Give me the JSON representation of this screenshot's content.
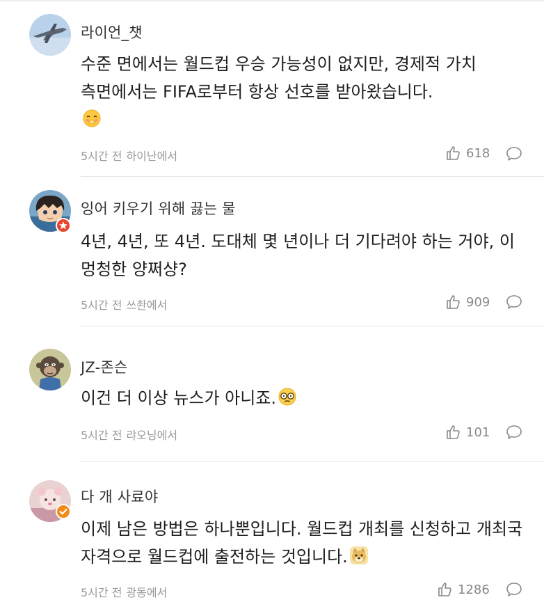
{
  "comments": [
    {
      "username": "라이언_챗",
      "text": "수준 면에서는 월드컵 우승 가능성이 없지만, 경제적 가치 측면에서는 FIFA로부터 항상 선호를 받아왔습니다.",
      "emoji": "shy-face-emoji",
      "time": "5시간 전",
      "location": "하이난에서",
      "likes": "618",
      "avatar": "jet-plane-avatar"
    },
    {
      "username": "잉어 키우기 위해 끓는 물",
      "text": "4년, 4년, 또 4년. 도대체 몇 년이나 더 기다려야 하는 거야, 이 멍청한 양쩌샹?",
      "emoji": "",
      "time": "5시간 전",
      "location": "쓰촨에서",
      "likes": "909",
      "avatar": "anime-boy-avatar",
      "badge": "star-badge"
    },
    {
      "username": "JZ-존슨",
      "text": "이건 더 이상 뉴스가 아니죠.",
      "emoji": "glasses-face-emoji",
      "time": "5시간 전",
      "location": "랴오닝에서",
      "likes": "101",
      "avatar": "ape-avatar"
    },
    {
      "username": "다 개 사료야",
      "text": "이제 남은 방법은 하나뿐입니다. 월드컵 개최를 신청하고 개최국 자격으로 월드컵에 출전하는 것입니다.",
      "emoji": "doge-emoji",
      "time": "5시간 전",
      "location": "광동에서",
      "likes": "1286",
      "avatar": "pink-character-avatar",
      "badge": "verified-badge"
    }
  ],
  "colors": {
    "meta": "#999999",
    "divider": "#e6e6e6",
    "badge_red": "#e8452c",
    "badge_orange": "#f28a1a"
  }
}
